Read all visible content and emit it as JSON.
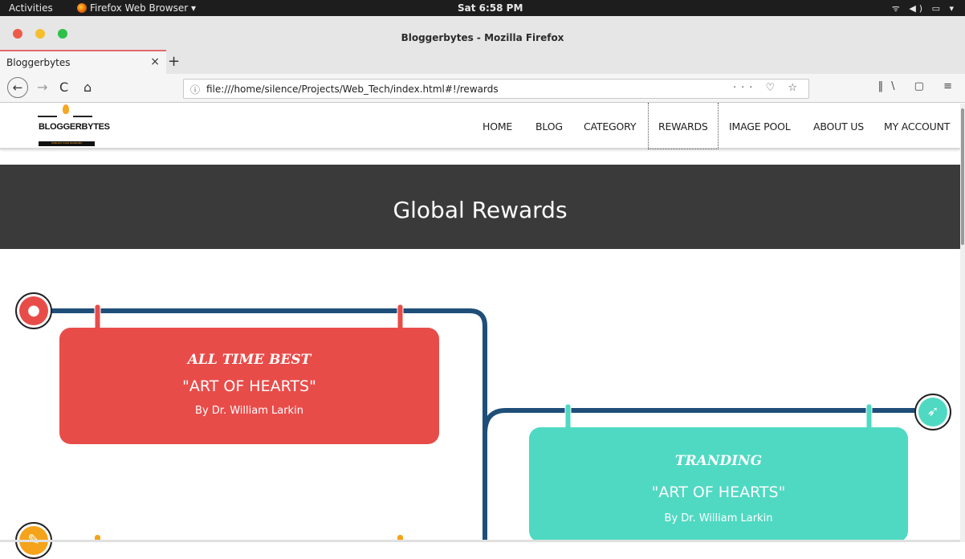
{
  "system_bar": {
    "activities": "Activities",
    "app_name": "Firefox Web Browser ▾",
    "clock": "Sat  6:58 PM",
    "tray": "wifi-icon volume-icon battery-icon"
  },
  "window": {
    "title": "Bloggerbytes - Mozilla Firefox"
  },
  "tabs": [
    {
      "label": "Bloggerbytes",
      "close": "×"
    }
  ],
  "new_tab": "+",
  "toolbar": {
    "back": "←",
    "forward": "→",
    "reload": "C",
    "home": "⌂",
    "info": "ⓘ",
    "url": "file:///home/silence/Projects/Web_Tech/index.html#!/rewards",
    "url_actions": "··· ♡ ☆",
    "right_icons": "‖\\ ▢ ≡"
  },
  "site": {
    "logo_name": "BLOGGERBYTES",
    "logo_tagline": "PUBLISH YOUR PASSIONS",
    "nav": [
      {
        "label": "HOME"
      },
      {
        "label": "BLOG"
      },
      {
        "label": "CATEGORY"
      },
      {
        "label": "REWARDS"
      },
      {
        "label": "IMAGE POOL"
      },
      {
        "label": "ABOUT US"
      },
      {
        "label": "MY ACCOUNT"
      }
    ],
    "hero_title": "Global Rewards"
  },
  "rewards": [
    {
      "title": "ALL TIME BEST",
      "work": "\"ART OF HEARTS\"",
      "author": "By Dr. William Larkin",
      "color": "#e84c49",
      "icon": "globe-icon"
    },
    {
      "title": "TRANDING",
      "work": "\"ART OF HEARTS\"",
      "author": "By Dr. William Larkin",
      "color": "#4fd9c2",
      "icon": "rocket-icon"
    },
    {
      "color": "#f5a31a",
      "icon": "edit-icon"
    }
  ],
  "colors": {
    "timeline_line": "#1f4e79",
    "hero_bg": "#3a3a3a"
  }
}
